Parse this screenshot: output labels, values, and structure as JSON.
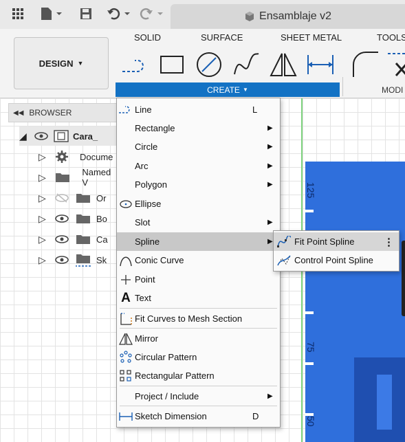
{
  "title_bar": {
    "document_title": "Ensamblaje v2"
  },
  "ribbon": {
    "workspace_label": "DESIGN",
    "tabs": [
      "SOLID",
      "SURFACE",
      "SHEET METAL",
      "TOOLS"
    ],
    "create_label": "CREATE",
    "modify_label": "MODI"
  },
  "browser": {
    "header": "BROWSER",
    "items": [
      {
        "label": "Cara_"
      },
      {
        "label": "Docume"
      },
      {
        "label": "Named V"
      },
      {
        "label": "Or"
      },
      {
        "label": "Bo"
      },
      {
        "label": "Ca"
      },
      {
        "label": "Sk"
      }
    ]
  },
  "create_menu": {
    "items": [
      {
        "label": "Line",
        "shortcut": "L",
        "icon": "line-icon"
      },
      {
        "label": "Rectangle",
        "submenu": true
      },
      {
        "label": "Circle",
        "submenu": true
      },
      {
        "label": "Arc",
        "submenu": true
      },
      {
        "label": "Polygon",
        "submenu": true
      },
      {
        "label": "Ellipse",
        "icon": "ellipse-icon"
      },
      {
        "label": "Slot",
        "submenu": true
      },
      {
        "label": "Spline",
        "submenu": true,
        "highlighted": true
      },
      {
        "label": "Conic Curve",
        "icon": "conic-curve-icon"
      },
      {
        "label": "Point",
        "icon": "point-icon"
      },
      {
        "label": "Text",
        "icon": "text-icon"
      },
      {
        "label": "Fit Curves to Mesh Section",
        "icon": "mesh-section-icon"
      },
      {
        "label": "Mirror",
        "icon": "mirror-icon"
      },
      {
        "label": "Circular Pattern",
        "icon": "circular-pattern-icon"
      },
      {
        "label": "Rectangular Pattern",
        "icon": "rectangular-pattern-icon"
      },
      {
        "label": "Project / Include",
        "submenu": true
      },
      {
        "label": "Sketch Dimension",
        "shortcut": "D",
        "icon": "dimension-icon"
      }
    ]
  },
  "spline_submenu": {
    "items": [
      {
        "label": "Fit Point Spline",
        "icon": "fit-point-spline-icon"
      },
      {
        "label": "Control Point Spline",
        "icon": "control-point-spline-icon"
      }
    ]
  },
  "canvas": {
    "dimension_labels": [
      "125",
      "75",
      "50"
    ]
  },
  "colors": {
    "accent": "#1372c4",
    "sketch_fill": "#2f6fdc",
    "axis_green": "#7fd37f"
  }
}
